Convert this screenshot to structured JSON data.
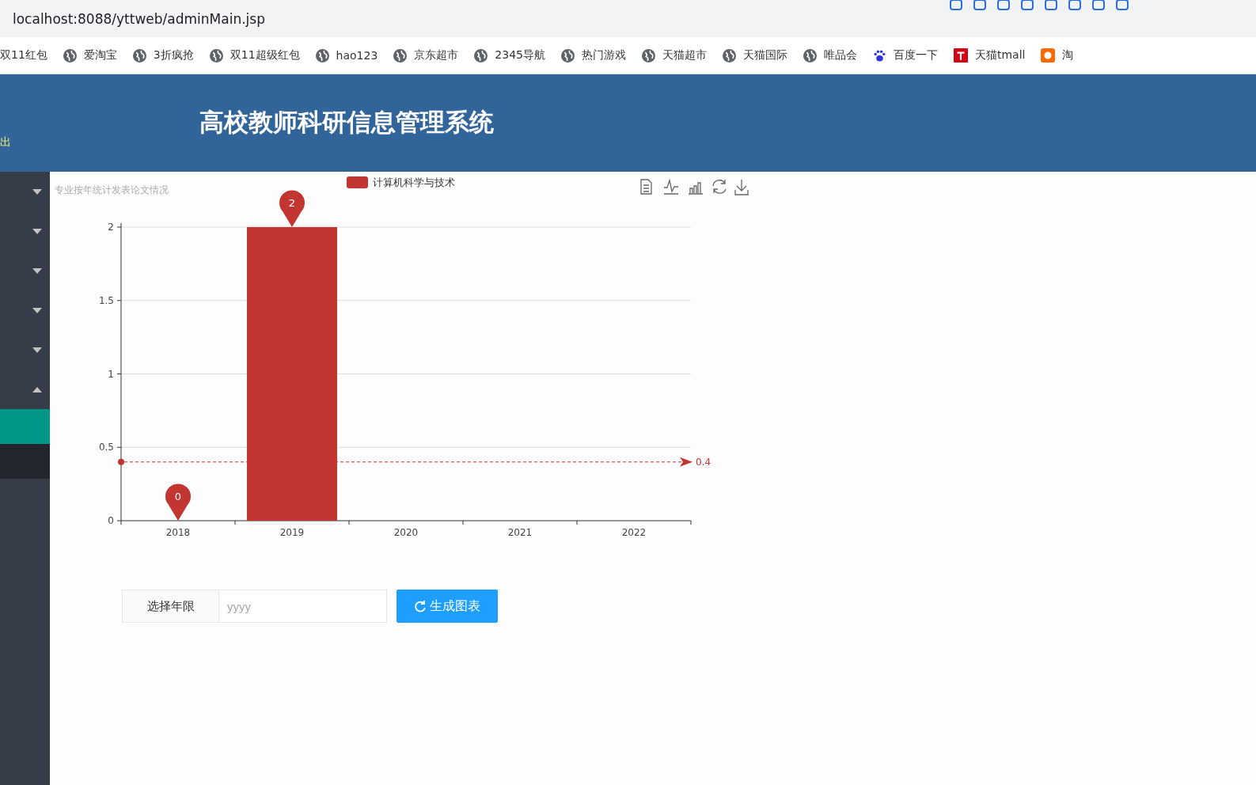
{
  "address_bar": {
    "url": "localhost:8088/yttweb/adminMain.jsp"
  },
  "bookmarks": [
    {
      "label": "双11红包",
      "kind": "none"
    },
    {
      "label": "爱淘宝",
      "kind": "globe"
    },
    {
      "label": "3折疯抢",
      "kind": "globe"
    },
    {
      "label": "双11超级红包",
      "kind": "globe"
    },
    {
      "label": "hao123",
      "kind": "globe"
    },
    {
      "label": "京东超市",
      "kind": "globe"
    },
    {
      "label": "2345导航",
      "kind": "globe"
    },
    {
      "label": "热门游戏",
      "kind": "globe"
    },
    {
      "label": "天猫超市",
      "kind": "globe"
    },
    {
      "label": "天猫国际",
      "kind": "globe"
    },
    {
      "label": "唯品会",
      "kind": "globe"
    },
    {
      "label": "百度一下",
      "kind": "paw"
    },
    {
      "label": "天猫tmall",
      "kind": "redsquare"
    },
    {
      "label": "淘",
      "kind": "orangesquare"
    }
  ],
  "header": {
    "left_text": "出",
    "title": "高校教师科研信息管理系统"
  },
  "sidebar": {
    "menus": [
      {
        "expanded": false
      },
      {
        "expanded": false
      },
      {
        "expanded": false
      },
      {
        "expanded": false
      },
      {
        "expanded": false
      },
      {
        "expanded": true
      }
    ],
    "submenu": [
      {
        "selected": true
      },
      {
        "selected": false
      }
    ]
  },
  "chart": {
    "chart_data": {
      "type": "bar",
      "title": "专业按年统计发表论文情况",
      "categories": [
        "2018",
        "2019",
        "2020",
        "2021",
        "2022"
      ],
      "series": [
        {
          "name": "计算机科学与技术",
          "color": "#c23531",
          "values": [
            0,
            2,
            0,
            0,
            0
          ]
        }
      ],
      "ylim": [
        0,
        2
      ],
      "yticks": [
        0,
        0.5,
        1,
        {
          "value": 1.5,
          "label": "1.5"
        },
        2
      ],
      "grid": true,
      "annotations": [
        {
          "text": "2",
          "x": "2019",
          "y": 2
        },
        {
          "text": "0",
          "x": "2018",
          "y": 0
        }
      ],
      "ref_lines": [
        {
          "axis": "y",
          "value": 0.4,
          "label": "0.4"
        }
      ]
    }
  },
  "form": {
    "label": "选择年限",
    "input": {
      "placeholder": "yyyy"
    },
    "button": "生成图表"
  }
}
